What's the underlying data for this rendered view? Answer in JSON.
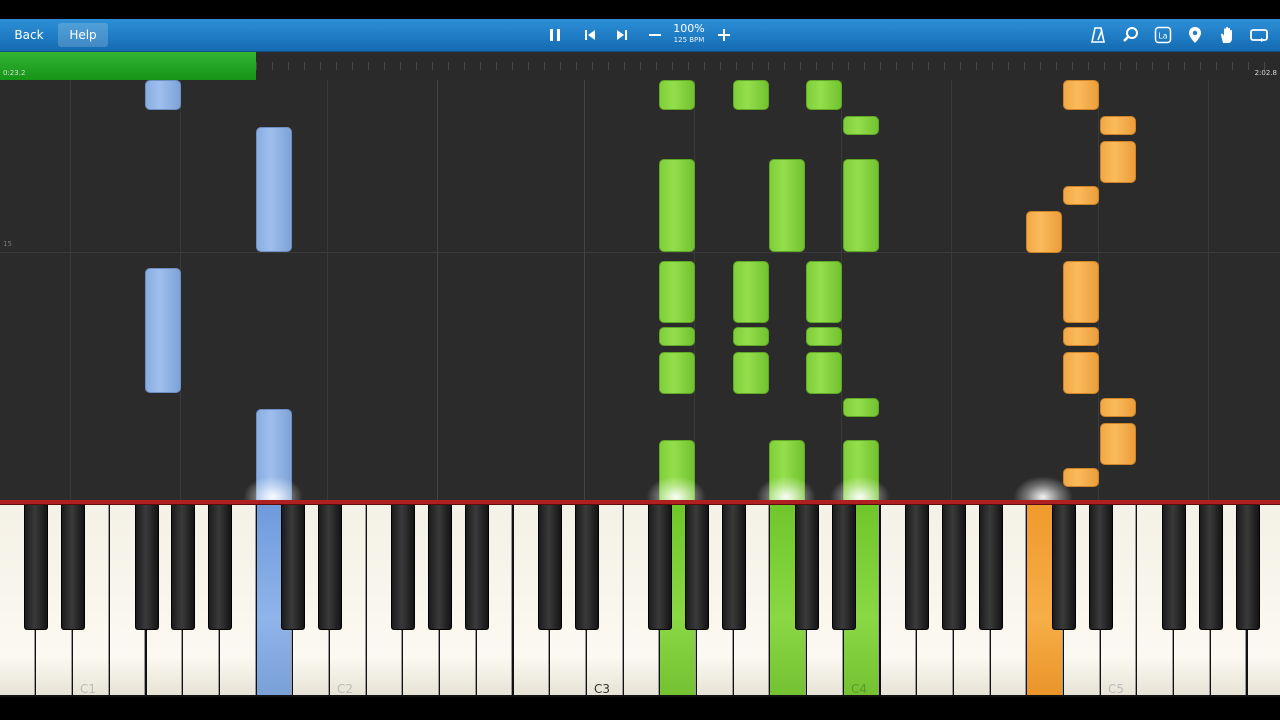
{
  "toolbar": {
    "back_label": "Back",
    "help_label": "Help",
    "speed_percent": "100%",
    "tempo": "125 BPM",
    "icons": [
      "pause-icon",
      "previous-icon",
      "next-icon",
      "minus-icon",
      "plus-icon",
      "metronome-icon",
      "search-icon",
      "label-icon",
      "marker-icon",
      "hand-icon",
      "loop-icon"
    ],
    "label_icon_text": "La"
  },
  "timeline": {
    "current_time": "0:23.2",
    "total_time": "2:02.8",
    "progress_fraction": 0.2
  },
  "roll": {
    "measure_number": "15"
  },
  "keyboard": {
    "labels": [
      "C1",
      "C2",
      "C3",
      "C4",
      "C5"
    ],
    "active_colors": {
      "left_hand": "#8fb4ea",
      "right_hand": "#8ad844",
      "other": "#f7ae47"
    }
  },
  "colors": {
    "toolbar": "#1f7cc4",
    "progress": "#22a522",
    "red_line": "#b02020",
    "background": "#2b2b2b"
  }
}
